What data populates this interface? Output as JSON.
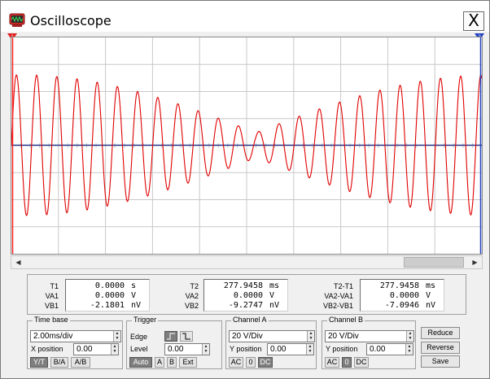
{
  "window": {
    "title": "Oscilloscope",
    "close_glyph": "X",
    "app_icon": "oscilloscope-app-icon",
    "close_icon": "close-icon"
  },
  "colors": {
    "trace_a": "#e00000",
    "trace_b": "#102080",
    "grid": "#c8c8c8",
    "cursor1": "#ff2020",
    "cursor2": "#2040c0"
  },
  "cursors": {
    "t1_tab": "1",
    "t2_tab": "2"
  },
  "readouts": {
    "cursor1": {
      "labels": [
        "T1",
        "VA1",
        "VB1"
      ],
      "values": [
        "0.0000",
        "0.0000",
        "-2.1801"
      ],
      "units": [
        "s",
        "V",
        "nV"
      ]
    },
    "cursor2": {
      "labels": [
        "T2",
        "VA2",
        "VB2"
      ],
      "values": [
        "277.9458",
        "0.0000",
        "-9.2747"
      ],
      "units": [
        "ms",
        "V",
        "nV"
      ]
    },
    "delta": {
      "labels": [
        "T2-T1",
        "VA2-VA1",
        "VB2-VB1"
      ],
      "values": [
        "277.9458",
        "0.0000",
        "-7.0946"
      ],
      "units": [
        "ms",
        "V",
        "nV"
      ]
    }
  },
  "timebase": {
    "title": "Time base",
    "scale": "2.00ms/div",
    "xpos_label": "X position",
    "xpos": "0.00",
    "modes": [
      "Y/T",
      "B/A",
      "A/B"
    ]
  },
  "trigger": {
    "title": "Trigger",
    "edge_label": "Edge",
    "level_label": "Level",
    "level": "0.00",
    "sources": [
      "Auto",
      "A",
      "B",
      "Ext"
    ]
  },
  "channel_a": {
    "title": "Channel A",
    "scale": "20 V/Div",
    "ypos_label": "Y position",
    "ypos": "0.00",
    "coupling": [
      "AC",
      "0",
      "DC"
    ]
  },
  "channel_b": {
    "title": "Channel B",
    "scale": "20 V/Div",
    "ypos_label": "Y position",
    "ypos": "0.00",
    "coupling": [
      "AC",
      "0",
      "DC"
    ]
  },
  "actions": {
    "reduce": "Reduce",
    "reverse": "Reverse",
    "save": "Save"
  }
}
